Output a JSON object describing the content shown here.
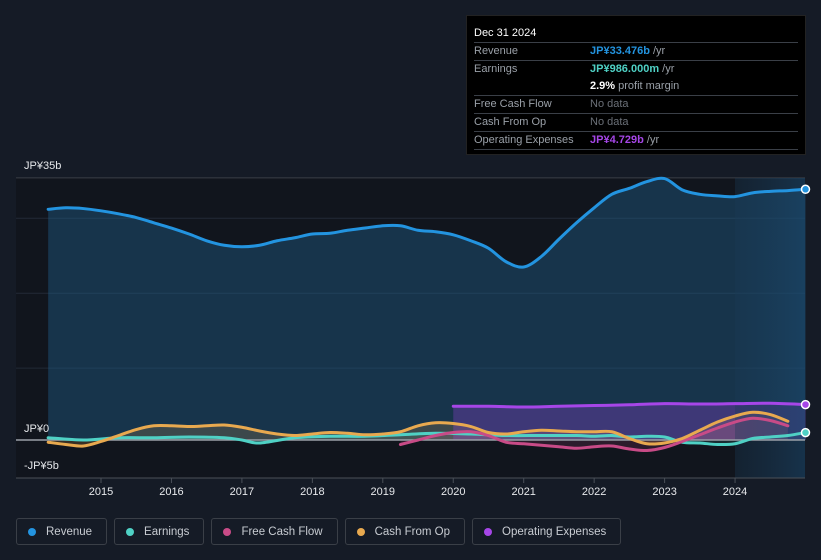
{
  "tooltip": {
    "date": "Dec 31 2024",
    "rows": [
      {
        "label": "Revenue",
        "value": "JP¥33.476b",
        "unit": " /yr",
        "color": "#2394e0"
      },
      {
        "label": "Earnings",
        "value": "JP¥986.000m",
        "unit": " /yr",
        "color": "#4fd1c5"
      },
      {
        "label": "",
        "value": "2.9%",
        "unit": " profit margin",
        "color": "#ffffff"
      },
      {
        "label": "Free Cash Flow",
        "value": "No data",
        "unit": "",
        "color": "#6b7078"
      },
      {
        "label": "Cash From Op",
        "value": "No data",
        "unit": "",
        "color": "#6b7078"
      },
      {
        "label": "Operating Expenses",
        "value": "JP¥4.729b",
        "unit": " /yr",
        "color": "#a646e8"
      }
    ]
  },
  "legend": [
    {
      "label": "Revenue",
      "color": "#2394e0"
    },
    {
      "label": "Earnings",
      "color": "#4fd1c5"
    },
    {
      "label": "Free Cash Flow",
      "color": "#c84b87"
    },
    {
      "label": "Cash From Op",
      "color": "#e8a94f"
    },
    {
      "label": "Operating Expenses",
      "color": "#a646e8"
    }
  ],
  "chart_data": {
    "type": "line",
    "title": "",
    "xlabel": "",
    "ylabel": "",
    "ylim": [
      -5,
      35
    ],
    "xlim": [
      2014.25,
      2025.0
    ],
    "y_tick_labels": [
      "JP¥35b",
      "JP¥0",
      "-JP¥5b"
    ],
    "x_tick_labels": [
      "2015",
      "2016",
      "2017",
      "2018",
      "2019",
      "2020",
      "2021",
      "2022",
      "2023",
      "2024"
    ],
    "series": [
      {
        "name": "Revenue",
        "color": "#2394e0",
        "x": [
          2014.25,
          2014.5,
          2014.75,
          2015.0,
          2015.25,
          2015.5,
          2015.75,
          2016.0,
          2016.25,
          2016.5,
          2016.75,
          2017.0,
          2017.25,
          2017.5,
          2017.75,
          2018.0,
          2018.25,
          2018.5,
          2018.75,
          2019.0,
          2019.25,
          2019.5,
          2019.75,
          2020.0,
          2020.25,
          2020.5,
          2020.75,
          2021.0,
          2021.25,
          2021.5,
          2021.75,
          2022.0,
          2022.25,
          2022.5,
          2022.75,
          2023.0,
          2023.25,
          2023.5,
          2023.75,
          2024.0,
          2024.25,
          2024.5,
          2024.75,
          2025.0
        ],
        "values": [
          30.8,
          31.0,
          30.9,
          30.6,
          30.2,
          29.7,
          29.0,
          28.3,
          27.5,
          26.6,
          26.0,
          25.8,
          26.0,
          26.6,
          27.0,
          27.5,
          27.6,
          28.0,
          28.3,
          28.6,
          28.6,
          28.0,
          27.8,
          27.4,
          26.6,
          25.6,
          23.8,
          23.1,
          24.5,
          26.8,
          29.0,
          31.0,
          32.8,
          33.6,
          34.5,
          34.9,
          33.4,
          32.8,
          32.6,
          32.5,
          33.0,
          33.2,
          33.3,
          33.476
        ]
      },
      {
        "name": "Earnings",
        "color": "#4fd1c5",
        "x": [
          2014.25,
          2014.75,
          2015.25,
          2015.75,
          2016.25,
          2016.75,
          2017.0,
          2017.25,
          2017.75,
          2018.25,
          2018.75,
          2019.25,
          2019.75,
          2020.25,
          2020.75,
          2021.25,
          2021.75,
          2022.0,
          2022.25,
          2022.5,
          2022.75,
          2023.0,
          2023.25,
          2023.5,
          2023.75,
          2024.0,
          2024.25,
          2024.5,
          2024.75,
          2025.0
        ],
        "values": [
          0.3,
          0.0,
          0.3,
          0.3,
          0.4,
          0.3,
          0.0,
          -0.4,
          0.3,
          0.5,
          0.5,
          0.7,
          0.9,
          0.8,
          0.6,
          0.6,
          0.6,
          0.5,
          0.6,
          0.4,
          0.5,
          0.4,
          -0.3,
          -0.4,
          -0.6,
          -0.5,
          0.2,
          0.4,
          0.6,
          0.986
        ]
      },
      {
        "name": "Free Cash Flow",
        "color": "#c84b87",
        "x": [
          2019.25,
          2019.5,
          2019.75,
          2020.0,
          2020.25,
          2020.5,
          2020.75,
          2021.0,
          2021.25,
          2021.5,
          2021.75,
          2022.0,
          2022.25,
          2022.5,
          2022.75,
          2023.0,
          2023.25,
          2023.5,
          2023.75,
          2024.0,
          2024.25,
          2024.5,
          2024.75
        ],
        "values": [
          -0.6,
          0.0,
          0.6,
          1.0,
          1.1,
          0.6,
          -0.3,
          -0.5,
          -0.7,
          -0.9,
          -1.1,
          -0.9,
          -0.8,
          -1.2,
          -1.4,
          -1.0,
          -0.2,
          0.7,
          1.6,
          2.4,
          2.9,
          2.6,
          1.9
        ]
      },
      {
        "name": "Cash From Op",
        "color": "#e8a94f",
        "x": [
          2014.25,
          2014.5,
          2014.75,
          2015.0,
          2015.25,
          2015.5,
          2015.75,
          2016.0,
          2016.25,
          2016.5,
          2016.75,
          2017.0,
          2017.25,
          2017.5,
          2017.75,
          2018.0,
          2018.25,
          2018.5,
          2018.75,
          2019.0,
          2019.25,
          2019.5,
          2019.75,
          2020.0,
          2020.25,
          2020.5,
          2020.75,
          2021.0,
          2021.25,
          2021.5,
          2021.75,
          2022.0,
          2022.25,
          2022.5,
          2022.75,
          2023.0,
          2023.25,
          2023.5,
          2023.75,
          2024.0,
          2024.25,
          2024.5,
          2024.75
        ],
        "values": [
          -0.3,
          -0.6,
          -0.8,
          -0.2,
          0.6,
          1.4,
          1.9,
          1.9,
          1.8,
          1.9,
          2.0,
          1.7,
          1.2,
          0.8,
          0.6,
          0.8,
          1.0,
          0.9,
          0.7,
          0.8,
          1.1,
          1.9,
          2.3,
          2.2,
          1.8,
          1.0,
          0.8,
          1.1,
          1.3,
          1.2,
          1.1,
          1.1,
          1.1,
          0.2,
          -0.5,
          -0.4,
          0.2,
          1.3,
          2.4,
          3.2,
          3.7,
          3.4,
          2.5
        ]
      },
      {
        "name": "Operating Expenses",
        "color": "#a646e8",
        "x": [
          2020.0,
          2020.5,
          2021.0,
          2021.5,
          2022.0,
          2022.5,
          2023.0,
          2023.5,
          2024.0,
          2024.5,
          2025.0
        ],
        "values": [
          4.5,
          4.5,
          4.4,
          4.5,
          4.6,
          4.7,
          4.85,
          4.8,
          4.85,
          4.9,
          4.729
        ]
      }
    ]
  }
}
